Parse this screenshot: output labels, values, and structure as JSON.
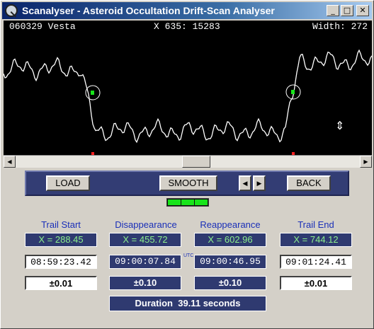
{
  "window": {
    "title": "Scanalyser - Asteroid Occultation Drift-Scan Analyser",
    "minimize": "_",
    "maximize": "□",
    "close": "✕"
  },
  "scope": {
    "target_label": "060329 Vesta",
    "cursor_readout": "X 635: 15283",
    "width_label": "Width: 272",
    "trace_color": "#ffffff",
    "marker_color": "#19e41b",
    "tick_color": "#ff2020",
    "resize_cursor_icon": "vertical-resize-icon"
  },
  "scrollbar": {
    "position": 0.5
  },
  "toolbar": {
    "load_label": "LOAD",
    "smooth_label": "SMOOTH",
    "prev_label": "◀",
    "next_label": "▶",
    "back_label": "BACK"
  },
  "indicator": {
    "lit_segments": 3
  },
  "columns": {
    "trail_start": {
      "title": "Trail Start",
      "x": "X = 288.45",
      "time": "08:59:23.42",
      "error": "±0.01"
    },
    "disappearance": {
      "title": "Disappearance",
      "x": "X = 455.72",
      "time": "09:00:07.84",
      "error": "±0.10"
    },
    "reappearance": {
      "title": "Reappearance",
      "x": "X = 602.96",
      "time": "09:00:46.95",
      "error": "±0.10"
    },
    "trail_end": {
      "title": "Trail End",
      "x": "X = 744.12",
      "time": "09:01:24.41",
      "error": "±0.01"
    }
  },
  "utc_label": "UTC",
  "duration": {
    "label": "Duration",
    "value": "39.11",
    "unit": "seconds"
  },
  "colors": {
    "title_gradient_start": "#0a246a",
    "panel_dark": "#2f3a70",
    "column_title": "#1a2fb8",
    "x_value_text": "#8cf08c"
  }
}
